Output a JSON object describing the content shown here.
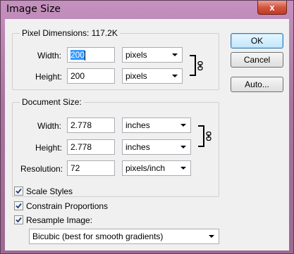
{
  "window": {
    "title": "Image Size",
    "close_glyph": "x"
  },
  "buttons": {
    "ok": "OK",
    "cancel": "Cancel",
    "auto": "Auto..."
  },
  "pixel_dimensions": {
    "title": "Pixel Dimensions:",
    "size": "117.2K",
    "width_label": "Width:",
    "width_value": "200",
    "width_unit": "pixels",
    "height_label": "Height:",
    "height_value": "200",
    "height_unit": "pixels"
  },
  "document_size": {
    "title": "Document Size:",
    "width_label": "Width:",
    "width_value": "2.778",
    "width_unit": "inches",
    "height_label": "Height:",
    "height_value": "2.778",
    "height_unit": "inches",
    "resolution_label": "Resolution:",
    "resolution_value": "72",
    "resolution_unit": "pixels/inch"
  },
  "options": {
    "scale_styles": {
      "label": "Scale Styles",
      "checked": true
    },
    "constrain_proportions": {
      "label": "Constrain Proportions",
      "checked": true
    },
    "resample_image": {
      "label": "Resample Image:",
      "checked": true
    }
  },
  "resample_method": "Bicubic (best for smooth gradients)",
  "icons": {
    "link": "chain-link-icon",
    "dropdown": "chevron-down-icon",
    "check": "checkmark-icon"
  }
}
